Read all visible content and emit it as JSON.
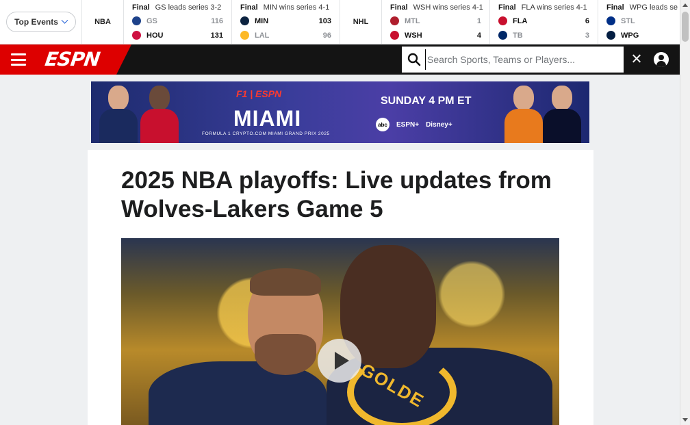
{
  "scoreboard": {
    "events_button": "Top Events",
    "leagues": [
      "NBA",
      "NHL"
    ],
    "games": [
      {
        "status": "Final",
        "note": "GS leads series 3-2",
        "teams": [
          {
            "abbr": "GS",
            "score": "116",
            "color": "#1d428a",
            "winner": false
          },
          {
            "abbr": "HOU",
            "score": "131",
            "color": "#ce1141",
            "winner": true
          }
        ]
      },
      {
        "status": "Final",
        "note": "MIN wins series 4-1",
        "teams": [
          {
            "abbr": "MIN",
            "score": "103",
            "color": "#0c2340",
            "winner": true
          },
          {
            "abbr": "LAL",
            "score": "96",
            "color": "#fdb927",
            "winner": false
          }
        ]
      },
      {
        "status": "Final",
        "note": "WSH wins series 4-1",
        "teams": [
          {
            "abbr": "MTL",
            "score": "1",
            "color": "#af1e2d",
            "winner": false
          },
          {
            "abbr": "WSH",
            "score": "4",
            "color": "#c8102e",
            "winner": true
          }
        ]
      },
      {
        "status": "Final",
        "note": "FLA wins series 4-1",
        "teams": [
          {
            "abbr": "FLA",
            "score": "6",
            "color": "#c8102e",
            "winner": true
          },
          {
            "abbr": "TB",
            "score": "3",
            "color": "#002868",
            "winner": false
          }
        ]
      },
      {
        "status": "Final",
        "note": "WPG leads se",
        "teams": [
          {
            "abbr": "STL",
            "score": "",
            "color": "#002f87",
            "winner": false
          },
          {
            "abbr": "WPG",
            "score": "",
            "color": "#041e42",
            "winner": true
          }
        ]
      }
    ]
  },
  "nav": {
    "brand": "ESPN",
    "search_placeholder": "Search Sports, Teams or Players..."
  },
  "ad": {
    "brand": "F1 | ESPN",
    "city": "MIAMI",
    "subtitle": "FORMULA 1 CRYPTO.COM MIAMI GRAND PRIX 2025",
    "time": "SUNDAY 4 PM ET",
    "networks": [
      "abc",
      "ESPN+",
      "Disney+"
    ]
  },
  "article": {
    "headline": "2025 NBA playoffs: Live updates from Wolves-Lakers Game 5",
    "jersey_text": "GOLDE"
  }
}
